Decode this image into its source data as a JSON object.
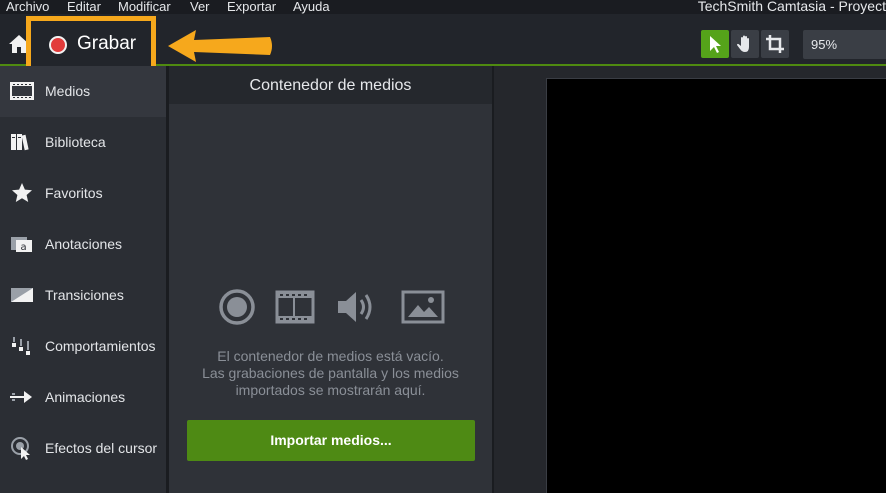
{
  "menubar": {
    "items": [
      "Archivo",
      "Editar",
      "Modificar",
      "Ver",
      "Exportar",
      "Ayuda"
    ],
    "app_title": "TechSmith Camtasia - Proyect"
  },
  "toolbar": {
    "record_label": "Grabar",
    "zoom_value": "95%",
    "colors": {
      "record": "#e23b3b",
      "highlight": "#f6a81c",
      "active_tool": "#55a31a"
    }
  },
  "sidebar": {
    "items": [
      {
        "label": "Medios",
        "icon": "film-icon"
      },
      {
        "label": "Biblioteca",
        "icon": "library-icon"
      },
      {
        "label": "Favoritos",
        "icon": "star-icon"
      },
      {
        "label": "Anotaciones",
        "icon": "annotation-icon"
      },
      {
        "label": "Transiciones",
        "icon": "transition-icon"
      },
      {
        "label": "Comportamientos",
        "icon": "behaviors-icon"
      },
      {
        "label": "Animaciones",
        "icon": "animation-icon"
      },
      {
        "label": "Efectos del cursor",
        "icon": "cursor-effects-icon"
      }
    ]
  },
  "media_bin": {
    "title": "Contenedor de medios",
    "empty_line1": "El contenedor de medios está vacío.",
    "empty_line2": "Las grabaciones de pantalla y los medios",
    "empty_line3": "importados se mostrarán aquí.",
    "import_button": "Importar medios...",
    "colors": {
      "button": "#4e8a14"
    }
  }
}
